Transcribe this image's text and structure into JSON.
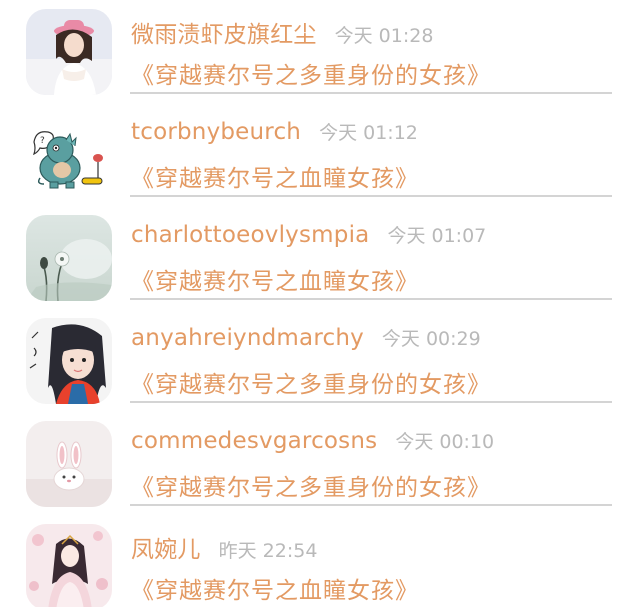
{
  "comments": [
    {
      "username": "微雨渍虾皮旗红尘",
      "time": "今天 01:28",
      "book_title": "《穿越赛尔号之多重身份的女孩》",
      "avatar_icon": "girl-pink-hat-photo-avatar"
    },
    {
      "username": "tcorbnybeurch",
      "time": "今天 01:12",
      "book_title": "《穿越赛尔号之血瞳女孩》",
      "avatar_icon": "cartoon-dinosaur-avatar"
    },
    {
      "username": "charlottoeovlysmpia",
      "time": "今天 01:07",
      "book_title": "《穿越赛尔号之血瞳女孩》",
      "avatar_icon": "dandelion-photo-avatar"
    },
    {
      "username": "anyahreiyndmarchy",
      "time": "今天 00:29",
      "book_title": "《穿越赛尔号之多重身份的女孩》",
      "avatar_icon": "girl-selfie-avatar"
    },
    {
      "username": "commedesvgarcosns",
      "time": "今天 00:10",
      "book_title": "《穿越赛尔号之多重身份的女孩》",
      "avatar_icon": "bunny-toy-avatar"
    },
    {
      "username": "凤婉儿",
      "time": "昨天 22:54",
      "book_title": "《穿越赛尔号之血瞳女孩》",
      "avatar_icon": "anime-girl-avatar"
    }
  ],
  "colors": {
    "accent": "#e39a63",
    "timestamp": "#b9b9b9",
    "divider": "#d4d4d4",
    "background": "#ffffff"
  }
}
